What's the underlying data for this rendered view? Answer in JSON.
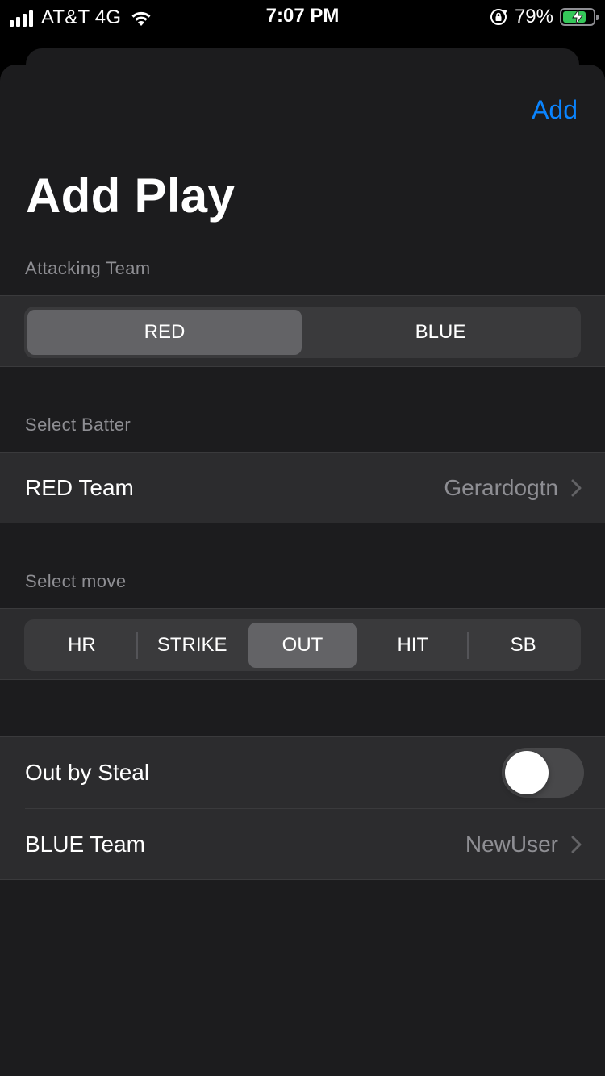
{
  "status_bar": {
    "carrier": "AT&T 4G",
    "time": "7:07 PM",
    "battery_percent": "79%",
    "battery_level": 0.79,
    "icons": [
      "signal-icon",
      "wifi-icon",
      "rotation-lock-icon",
      "battery-charging-icon"
    ]
  },
  "nav": {
    "add_label": "Add"
  },
  "page": {
    "title": "Add Play"
  },
  "attacking_team": {
    "header": "Attacking Team",
    "options": [
      "RED",
      "BLUE"
    ],
    "selected": "RED"
  },
  "batter": {
    "header": "Select Batter",
    "label": "RED Team",
    "value": "Gerardogtn"
  },
  "move": {
    "header": "Select move",
    "options": [
      "HR",
      "STRIKE",
      "OUT",
      "HIT",
      "SB"
    ],
    "selected": "OUT"
  },
  "out_details": {
    "steal_label": "Out by Steal",
    "steal_on": false,
    "team_label": "BLUE Team",
    "team_value": "NewUser"
  },
  "colors": {
    "accent": "#0a84ff",
    "background": "#1c1c1e",
    "cell": "#2c2c2e",
    "secondary_text": "#8e8e93",
    "battery_fill": "#34c759"
  }
}
